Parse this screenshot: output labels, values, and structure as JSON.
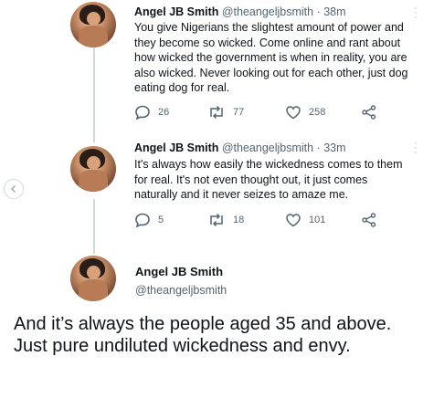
{
  "tweets": [
    {
      "name": "Angel JB Smith",
      "handle": "@theangeljbsmith",
      "time": "· 38m",
      "text": "You give Nigerians the slightest amount of power and they become so wicked. Come online and rant about how wicked the government is when in reality, you are also wicked. Never looking out for each other, just dog eating dog for real.",
      "replies": "26",
      "retweets": "77",
      "likes": "258"
    },
    {
      "name": "Angel JB Smith",
      "handle": "@theangeljbsmith",
      "time": "· 33m",
      "text": "It's always how easily the wickedness comes to them for real. It's not even thought out, it just comes naturally and it never seizes to amaze me.",
      "replies": "5",
      "retweets": "18",
      "likes": "101"
    }
  ],
  "main_tweet": {
    "name": "Angel JB Smith",
    "handle": "@theangeljbsmith",
    "text": "And it’s always the people aged 35 and above. Just pure undiluted wickedness and envy."
  },
  "icons": {
    "reply": "reply-icon",
    "retweet": "retweet-icon",
    "like": "heart-icon",
    "share": "share-icon",
    "more": "more-icon",
    "prev": "chevron-left-icon"
  },
  "colors": {
    "text": "#0f1419",
    "secondary": "#536471",
    "thread_line": "#cfd9de"
  }
}
